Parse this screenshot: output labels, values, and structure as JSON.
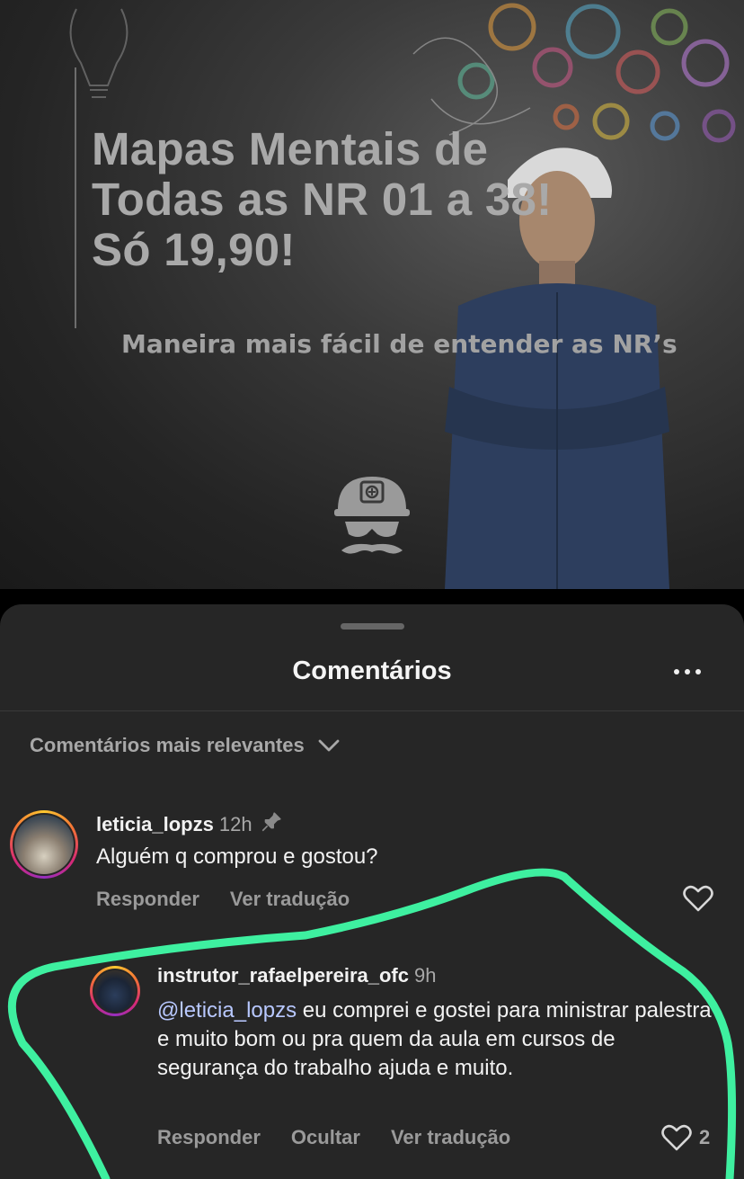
{
  "ad": {
    "headline": [
      "Mapas Mentais de",
      "Todas as NR 01 a 38!",
      "Só 19,90!"
    ],
    "subline": "Maneira mais fácil de entender as NR’s"
  },
  "sheet": {
    "title": "Comentários",
    "sort_label": "Comentários mais relevantes"
  },
  "comments": [
    {
      "username": "leticia_lopzs",
      "time": "12h",
      "pinned": true,
      "text": "Alguém q comprou e gostou?",
      "actions": [
        "Responder",
        "Ver tradução"
      ],
      "likes": ""
    },
    {
      "username": "instrutor_rafaelpereira_ofc",
      "time": "9h",
      "mention": "@leticia_lopzs",
      "text": " eu comprei e gostei para ministrar palestra e muito bom ou pra quem da aula em cursos de segurança do trabalho ajuda e muito.",
      "actions": [
        "Responder",
        "Ocultar",
        "Ver tradução"
      ],
      "likes": "2"
    }
  ],
  "colors": {
    "sheet_bg": "#262626",
    "highlight_stroke": "#3ef0a0",
    "mention": "#b8c8ff"
  }
}
